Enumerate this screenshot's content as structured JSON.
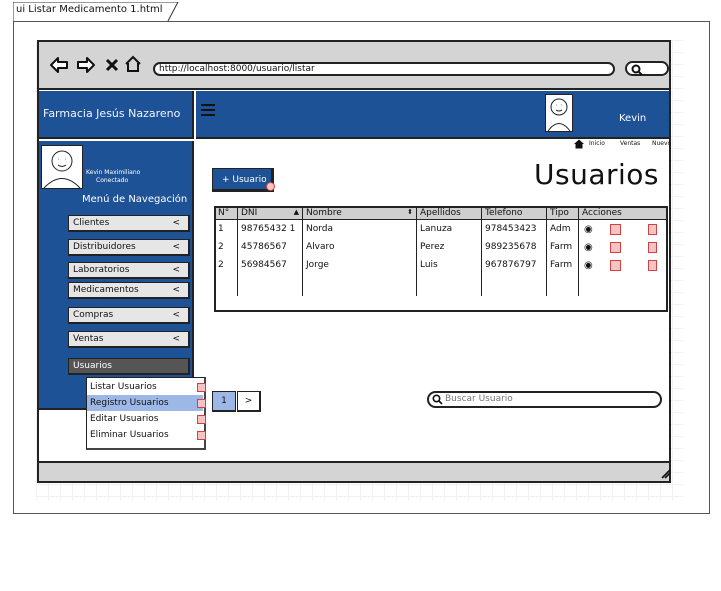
{
  "file_tab": {
    "title": "ui Listar Medicamento 1.html"
  },
  "browser": {
    "url": "http://localhost:8000/usuario/listar"
  },
  "brand": {
    "title": "Farmacia Jesús Nazareno"
  },
  "user": {
    "name": "Kevin",
    "full_name": "Kevin Maximiliano",
    "status": "Conectado"
  },
  "sidebar": {
    "heading": "Menú de Navegación",
    "items": [
      {
        "label": "Clientes",
        "chevron": "<"
      },
      {
        "label": "Distribuidores",
        "chevron": "<"
      },
      {
        "label": "Laboratorios",
        "chevron": "<"
      },
      {
        "label": "Medicamentos",
        "chevron": "<"
      },
      {
        "label": "Compras",
        "chevron": "<"
      },
      {
        "label": "Ventas",
        "chevron": "<"
      },
      {
        "label": "Usuarios"
      }
    ],
    "submenu": [
      "Listar Usuarios",
      "Registro Usuarios",
      "Editar Usuarios",
      "Eliminar Usuarios"
    ]
  },
  "breadcrumb": [
    "Inicio",
    "Ventas",
    "Nuevo"
  ],
  "page": {
    "title": "Usuarios",
    "add_button": "+ Usuario"
  },
  "table": {
    "headers": [
      "N°",
      "DNI",
      "Nombre",
      "Apellidos",
      "Telefono",
      "Tipo",
      "Acciones"
    ],
    "rows": [
      {
        "n": "1",
        "dni": "98765432 1",
        "nombre": "Norda",
        "apellidos": "Lanuza",
        "telefono": "978453423",
        "tipo": "Adm"
      },
      {
        "n": "2",
        "dni": "45786567",
        "nombre": "Alvaro",
        "apellidos": "Perez",
        "telefono": "989235678",
        "tipo": "Farm"
      },
      {
        "n": "2",
        "dni": "56984567",
        "nombre": "Jorge",
        "apellidos": "Luis",
        "telefono": "967876797",
        "tipo": "Farm"
      }
    ]
  },
  "pagination": {
    "current": "1",
    "next": ">"
  },
  "search": {
    "placeholder": "Buscar Usuario"
  },
  "colors": {
    "primary": "#1e5297",
    "chrome": "#d4d4d4",
    "selected": "#9db8e6"
  }
}
